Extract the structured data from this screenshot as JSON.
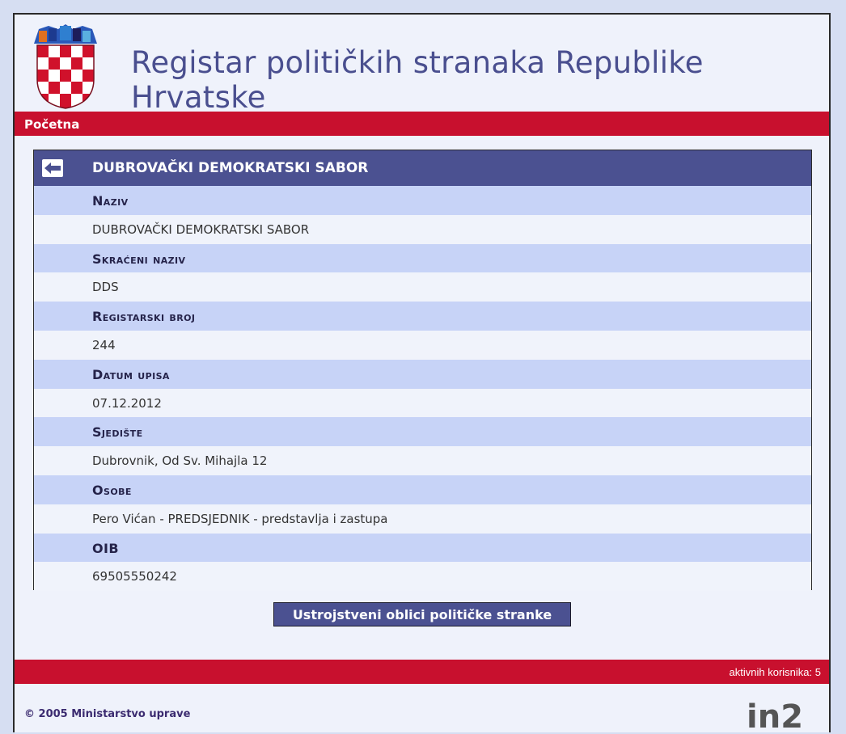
{
  "header": {
    "title": "Registar političkih stranaka Republike Hrvatske"
  },
  "nav": {
    "home": "Početna"
  },
  "detail": {
    "heading": "DUBROVAČKI DEMOKRATSKI SABOR",
    "fields": [
      {
        "label": "Naziv",
        "value": "DUBROVAČKI DEMOKRATSKI SABOR"
      },
      {
        "label": "Skraćeni naziv",
        "value": "DDS"
      },
      {
        "label": "Registarski broj",
        "value": "244"
      },
      {
        "label": "Datum upisa",
        "value": "07.12.2012"
      },
      {
        "label": "Sjedište",
        "value": "Dubrovnik, Od Sv. Mihajla 12"
      },
      {
        "label": "Osobe",
        "value": "Pero Vićan - PREDSJEDNIK - predstavlja i zastupa"
      },
      {
        "label": "OIB",
        "value": "69505550242"
      }
    ]
  },
  "actions": {
    "org_button": "Ustrojstveni oblici političke stranke"
  },
  "status": {
    "active_users": "aktivnih korisnika: 5"
  },
  "footer": {
    "copyright": "© 2005 Ministarstvo uprave",
    "logo_text": "in2"
  },
  "colors": {
    "accent_red": "#c8102e",
    "header_blue": "#4b5191",
    "label_row": "#c7d3f7"
  }
}
